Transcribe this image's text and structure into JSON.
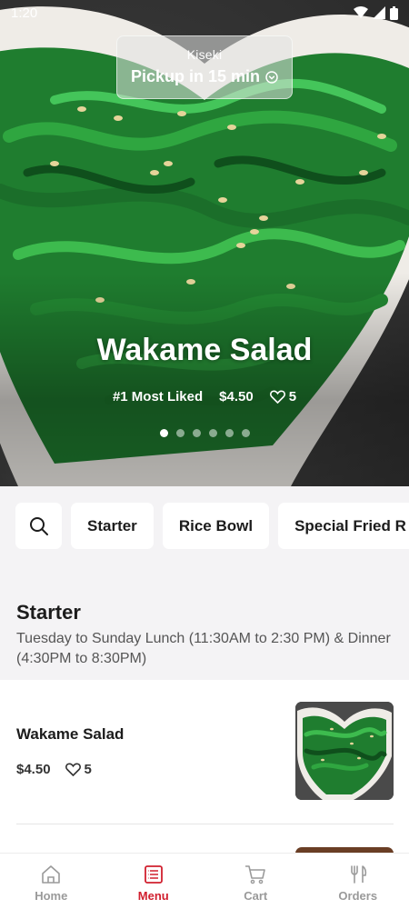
{
  "status_bar": {
    "time": "1:20"
  },
  "pickup": {
    "store_name": "Kiseki",
    "eta_label": "Pickup in 15 min"
  },
  "hero": {
    "title": "Wakame Salad",
    "badge": "#1 Most Liked",
    "price": "$4.50",
    "likes": "5",
    "slide_count": 6,
    "active_slide": 1
  },
  "categories": [
    "Starter",
    "Rice Bowl",
    "Special Fried R"
  ],
  "section": {
    "title": "Starter",
    "subtitle": "Tuesday to Sunday Lunch (11:30AM to 2:30 PM) & Dinner (4:30PM to 8:30PM)"
  },
  "items": [
    {
      "name": "Wakame Salad",
      "price": "$4.50",
      "likes": "5"
    }
  ],
  "bottom_nav": {
    "items": [
      {
        "label": "Home",
        "icon": "home-icon"
      },
      {
        "label": "Menu",
        "icon": "menu-icon"
      },
      {
        "label": "Cart",
        "icon": "cart-icon"
      },
      {
        "label": "Orders",
        "icon": "fork-knife-icon"
      }
    ],
    "active": "Menu"
  },
  "colors": {
    "accent": "#d1202f",
    "background": "#f4f3f5"
  }
}
